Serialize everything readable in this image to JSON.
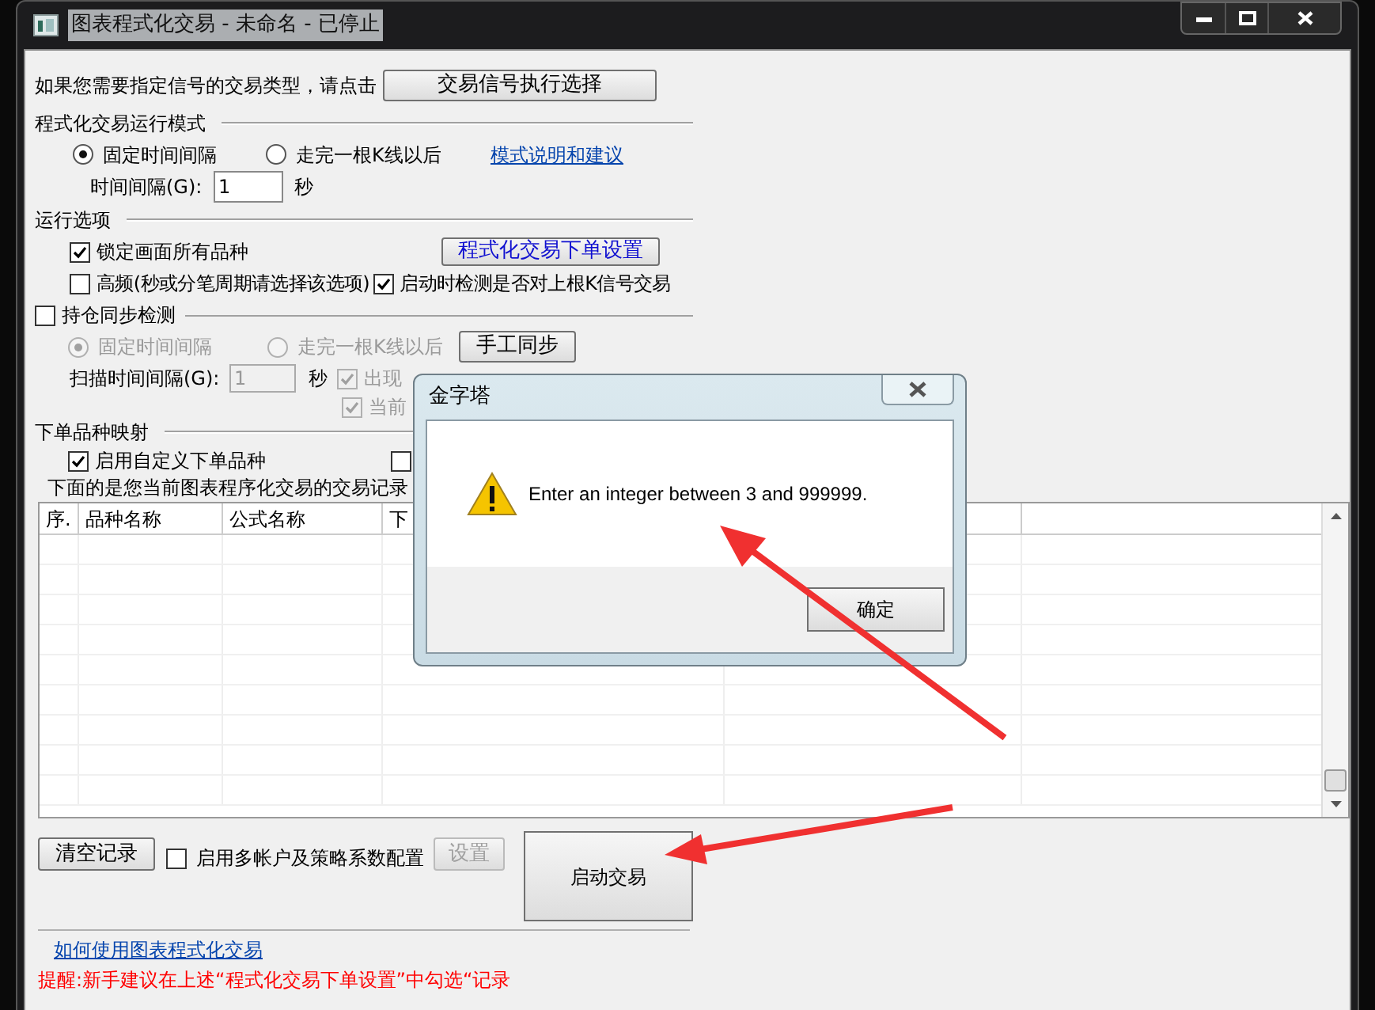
{
  "window": {
    "title": "图表程式化交易 - 未命名 - 已停止"
  },
  "signal_prompt": {
    "text": "如果您需要指定信号的交易类型，请点击",
    "button": "交易信号执行选择"
  },
  "run_mode": {
    "title": "程式化交易运行模式",
    "options": [
      {
        "label": "固定时间间隔",
        "selected": true
      },
      {
        "label": "走完一根K线以后",
        "selected": false
      }
    ],
    "link": "模式说明和建议",
    "interval_label": "时间间隔(G):",
    "interval_value": "1",
    "unit": "秒"
  },
  "run_options": {
    "title": "运行选项",
    "checkboxes": [
      {
        "label": "锁定画面所有品种",
        "checked": true
      },
      {
        "label": "高频(秒或分笔周期请选择该选项)",
        "checked": false
      },
      {
        "label": "启动时检测是否对上根K信号交易",
        "checked": true
      }
    ],
    "button": "程式化交易下单设置"
  },
  "position_sync": {
    "title": "持仓同步检测",
    "checked": false,
    "options": [
      {
        "label": "固定时间间隔",
        "selected": true,
        "disabled": true
      },
      {
        "label": "走完一根K线以后",
        "selected": false,
        "disabled": true
      }
    ],
    "button": "手工同步",
    "scan_label": "扫描时间间隔(G):",
    "scan_value": "1",
    "unit": "秒",
    "checkboxes": [
      {
        "label": "出现",
        "checked": true,
        "disabled": true
      },
      {
        "label": "当前",
        "checked": true,
        "disabled": true
      }
    ]
  },
  "order_mapping": {
    "title": "下单品种映射",
    "checkboxes": [
      {
        "label": "启用自定义下单品种",
        "checked": true
      },
      {
        "checked": false
      }
    ]
  },
  "records": {
    "caption": "下面的是您当前图表程序化交易的交易记录",
    "columns": [
      "序.",
      "品种名称",
      "公式名称",
      "下"
    ]
  },
  "bottom": {
    "clear_button": "清空记录",
    "multi_account": {
      "label": "启用多帐户及策略系数配置",
      "checked": false
    },
    "settings_button": {
      "label": "设置",
      "disabled": true
    },
    "start_button": "启动交易"
  },
  "help_link": "如何使用图表程式化交易",
  "reminder": "提醒:新手建议在上述“程式化交易下单设置”中勾选“记录",
  "dialog": {
    "title": "金字塔",
    "message": "Enter an integer between 3 and 999999.",
    "button": "确定"
  }
}
